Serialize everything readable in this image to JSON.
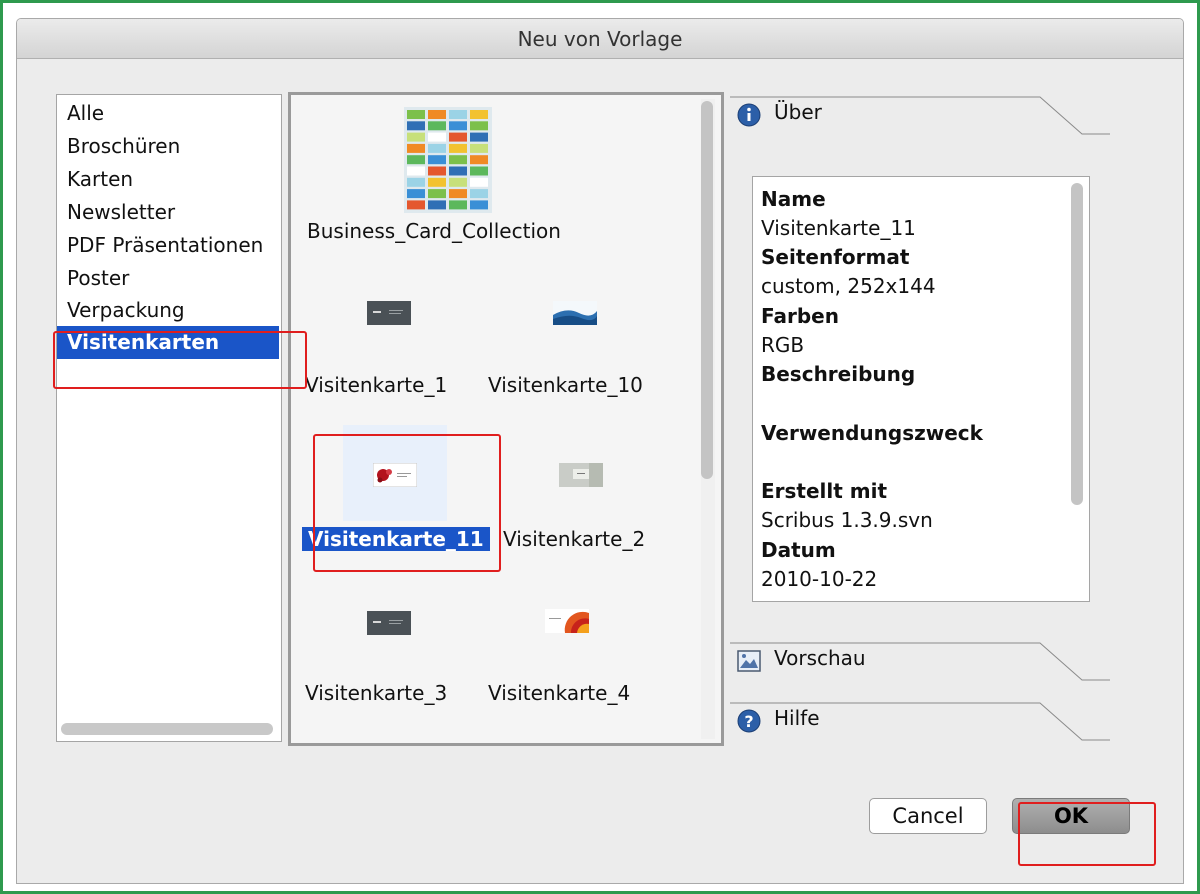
{
  "window": {
    "title": "Neu von Vorlage"
  },
  "categories": {
    "items": [
      "Alle",
      "Broschüren",
      "Karten",
      "Newsletter",
      "PDF Präsentationen",
      "Poster",
      "Verpackung",
      "Visitenkarten"
    ],
    "selected": "Visitenkarten"
  },
  "templates": {
    "items": [
      {
        "name": "Business_Card_Collection"
      },
      {
        "name": "Visitenkarte_1"
      },
      {
        "name": "Visitenkarte_10"
      },
      {
        "name": "Visitenkarte_11"
      },
      {
        "name": "Visitenkarte_2"
      },
      {
        "name": "Visitenkarte_3"
      },
      {
        "name": "Visitenkarte_4"
      }
    ],
    "selected": "Visitenkarte_11"
  },
  "sections": {
    "about": {
      "title": "Über",
      "icon": "info-icon"
    },
    "preview": {
      "title": "Vorschau",
      "icon": "image-icon"
    },
    "help": {
      "title": "Hilfe",
      "icon": "help-icon"
    }
  },
  "details": {
    "name_label": "Name",
    "name_value": "Visitenkarte_11",
    "pageformat_label": "Seitenformat",
    "pageformat_value": "custom, 252x144",
    "colors_label": "Farben",
    "colors_value": "RGB",
    "description_label": "Beschreibung",
    "description_value": "",
    "usage_label": "Verwendungszweck",
    "usage_value": "",
    "created_label": "Erstellt mit",
    "created_value": "Scribus 1.3.9.svn",
    "date_label": "Datum",
    "date_value": "2010-10-22"
  },
  "buttons": {
    "cancel": "Cancel",
    "ok": "OK"
  },
  "colors": {
    "selection": "#1a55c8",
    "highlight": "#e01e1e",
    "frame": "#2e9a4e"
  }
}
